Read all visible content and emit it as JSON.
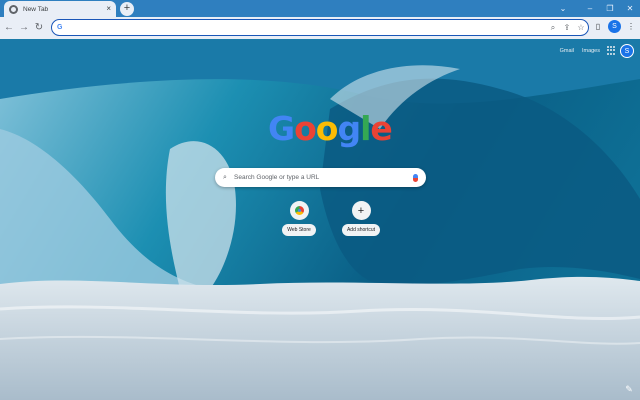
{
  "window": {
    "tab_title": "New Tab",
    "tab_close": "×",
    "new_tab_symbol": "+",
    "controls": {
      "tab_search": "⌄",
      "minimize": "–",
      "restore": "❐",
      "close": "✕"
    }
  },
  "toolbar": {
    "back": "←",
    "forward": "→",
    "reload": "↻",
    "omnibox_favicon": "G",
    "omnibox_value": "",
    "profile_initial": "S"
  },
  "ntp": {
    "links": [
      "Gmail",
      "Images"
    ],
    "profile_initial": "S",
    "logo_letters": [
      {
        "char": "G",
        "color": "#4285f4"
      },
      {
        "char": "o",
        "color": "#ea4335"
      },
      {
        "char": "o",
        "color": "#fbbc05"
      },
      {
        "char": "g",
        "color": "#4285f4"
      },
      {
        "char": "l",
        "color": "#34a853"
      },
      {
        "char": "e",
        "color": "#ea4335"
      }
    ],
    "search_placeholder": "Search Google or type a URL",
    "shortcuts": [
      {
        "label": "Web Store",
        "icon": "web-store-icon"
      },
      {
        "label": "Add shortcut",
        "icon": "plus-icon",
        "symbol": "+"
      }
    ],
    "customize_icon": "pencil-icon"
  },
  "colors": {
    "accent": "#1a73e8",
    "tabstrip": "#2f7fbf",
    "toolbar": "#e9eef6"
  }
}
